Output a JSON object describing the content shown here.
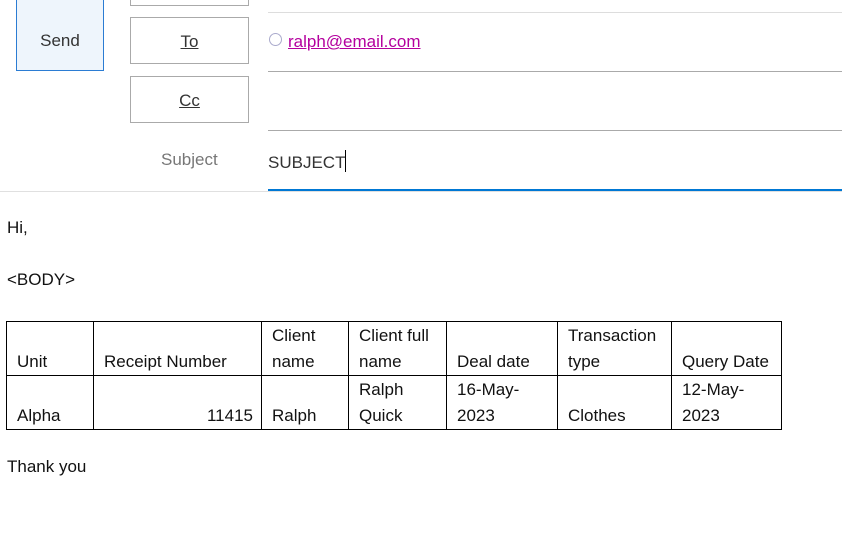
{
  "header": {
    "send_label": "Send",
    "to_label": "To",
    "cc_label": "Cc",
    "subject_label": "Subject",
    "to_recipient": "ralph@email.com",
    "subject_value": "SUBJECT"
  },
  "body": {
    "greeting": "Hi,",
    "placeholder": "<BODY>",
    "closing": "Thank you",
    "table": {
      "headers": [
        "Unit",
        "Receipt Number",
        "Client name",
        "Client full name",
        "Deal date",
        "Transaction type",
        "Query Date"
      ],
      "rows": [
        [
          "Alpha",
          "11415",
          "Ralph",
          "Ralph Quick",
          "16-May-2023",
          "Clothes",
          "12-May-2023"
        ]
      ]
    }
  },
  "colors": {
    "accent": "#0078d4",
    "link": "#b4009e"
  }
}
